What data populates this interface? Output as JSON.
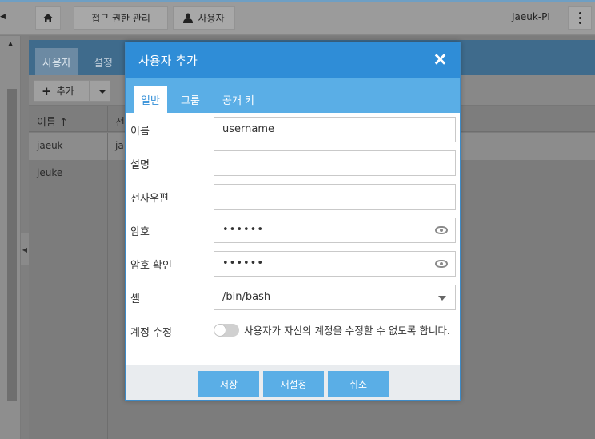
{
  "topbar": {
    "home_icon": "home-icon",
    "access_manage_label": "접근 권한 관리",
    "users_label": "사용자",
    "host_label": "Jaeuk-PI"
  },
  "panel": {
    "tabs": [
      {
        "label": "사용자",
        "active": true
      },
      {
        "label": "설정",
        "active": false
      }
    ],
    "toolbar": {
      "add_label": "추가"
    },
    "table": {
      "columns": [
        "이름",
        "전"
      ],
      "rows": [
        {
          "name": "jaeuk",
          "desc": "ja"
        },
        {
          "name": "jeuke",
          "desc": ""
        }
      ]
    }
  },
  "modal": {
    "title": "사용자 추가",
    "tabs": [
      {
        "label": "일반",
        "active": true
      },
      {
        "label": "그룹",
        "active": false
      },
      {
        "label": "공개 키",
        "active": false
      }
    ],
    "fields": {
      "name": {
        "label": "이름",
        "value": "username"
      },
      "description": {
        "label": "설명",
        "value": ""
      },
      "email": {
        "label": "전자우편",
        "value": ""
      },
      "password": {
        "label": "암호",
        "value": "••••••"
      },
      "password_confirm": {
        "label": "암호 확인",
        "value": "••••••"
      },
      "shell": {
        "label": "셸",
        "value": "/bin/bash"
      },
      "account_edit": {
        "label": "계정 수정",
        "text": "사용자가 자신의 계정을 수정할 수 없도록 합니다.",
        "enabled": false
      }
    },
    "buttons": {
      "save": "저장",
      "reset": "재설정",
      "cancel": "취소"
    }
  },
  "colors": {
    "accent": "#2f8dd7",
    "tab_bar": "#5aaee6",
    "footer": "#e9ecef"
  }
}
